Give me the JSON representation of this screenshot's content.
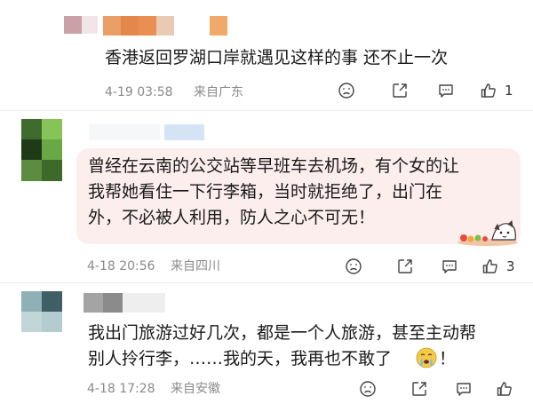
{
  "comments": [
    {
      "text": "香港返回罗湖口岸就遇见这样的事 还不止一次",
      "time": "4-19 03:58",
      "location": "来自广东",
      "likes": "1"
    },
    {
      "text_lines": [
        "曾经在云南的公交站等早班车去机场，有个女的让",
        "我帮她看住一下行李箱，当时就拒绝了，出门在",
        "外，不必被人利用，防人之心不可无！"
      ],
      "time": "4-18 20:56",
      "location": "来自四川",
      "likes": "3"
    },
    {
      "text_lines": [
        "我出门旅游过好几次，都是一个人旅游，甚至主动帮",
        "别人拎行李，……我的天，我再也不敢了",
        "！"
      ],
      "time": "4-18 17:28",
      "location": "来自安徽",
      "likes": ""
    }
  ],
  "colors": {
    "highlight": "#fdeeee",
    "meta": "#8a8a8a",
    "text": "#1a1a1a"
  },
  "icons": [
    "dislike-icon",
    "share-icon",
    "comment-icon",
    "like-icon",
    "crying-emoji-icon",
    "sticker-icon"
  ]
}
